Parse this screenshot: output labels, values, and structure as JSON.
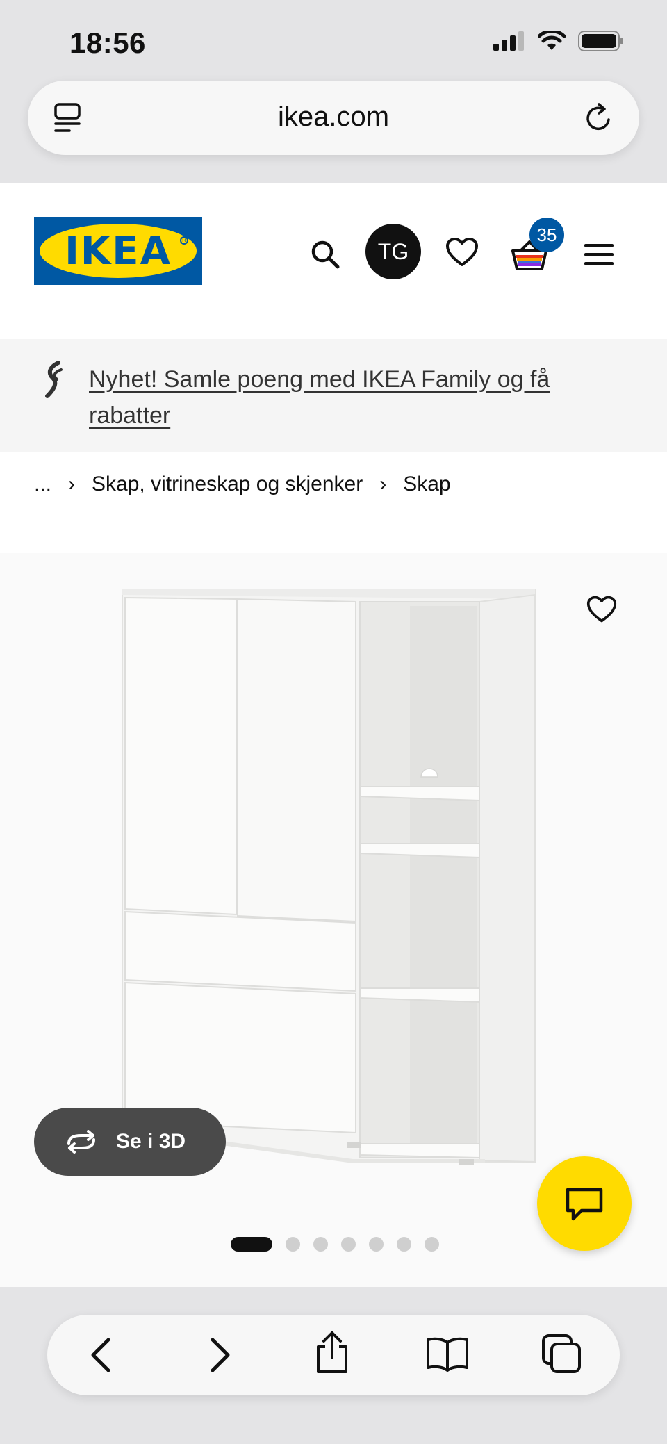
{
  "status_bar": {
    "time": "18:56"
  },
  "browser": {
    "url": "ikea.com"
  },
  "header": {
    "logo_text": "IKEA",
    "avatar_initials": "TG",
    "cart_count": "35",
    "brand_colors": {
      "blue": "#0058a3",
      "yellow": "#ffdb00"
    }
  },
  "promo": {
    "text": "Nyhet! Samle poeng med IKEA Family og få rabatter"
  },
  "breadcrumb": {
    "items": [
      "...",
      "Skap, vitrineskap og skjenker",
      "Skap"
    ]
  },
  "product_image": {
    "view_3d_label": "Se i 3D",
    "carousel": {
      "total": 7,
      "active_index": 0
    }
  },
  "icons": {
    "tabs": "tabs-icon",
    "reload": "reload-icon",
    "search": "search-icon",
    "wishlist": "heart-icon",
    "cart": "cart-icon",
    "menu": "hamburger-menu-icon",
    "chat": "chat-icon",
    "back": "back-arrow-icon",
    "forward": "forward-arrow-icon",
    "share": "share-icon",
    "bookmarks": "bookmarks-icon",
    "tabs_overview": "tabs-overview-icon"
  }
}
